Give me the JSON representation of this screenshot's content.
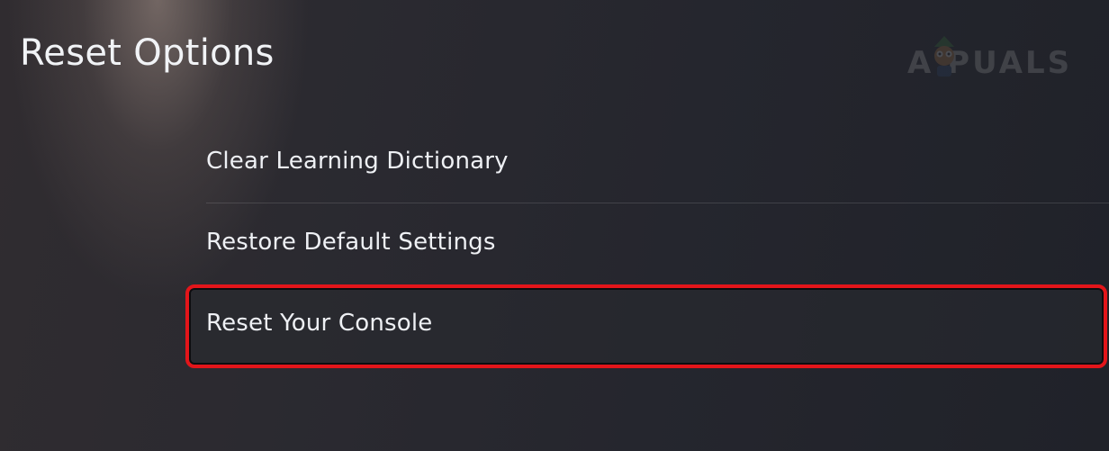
{
  "header": {
    "title": "Reset Options"
  },
  "watermark": {
    "text": "A  PUALS"
  },
  "menu": {
    "items": [
      {
        "label": "Clear Learning Dictionary"
      },
      {
        "label": "Restore Default Settings"
      },
      {
        "label": "Reset Your Console",
        "highlighted": true
      }
    ]
  },
  "colors": {
    "highlight_border": "#e3151a",
    "text": "#eef0f4",
    "background": "#25262e"
  }
}
